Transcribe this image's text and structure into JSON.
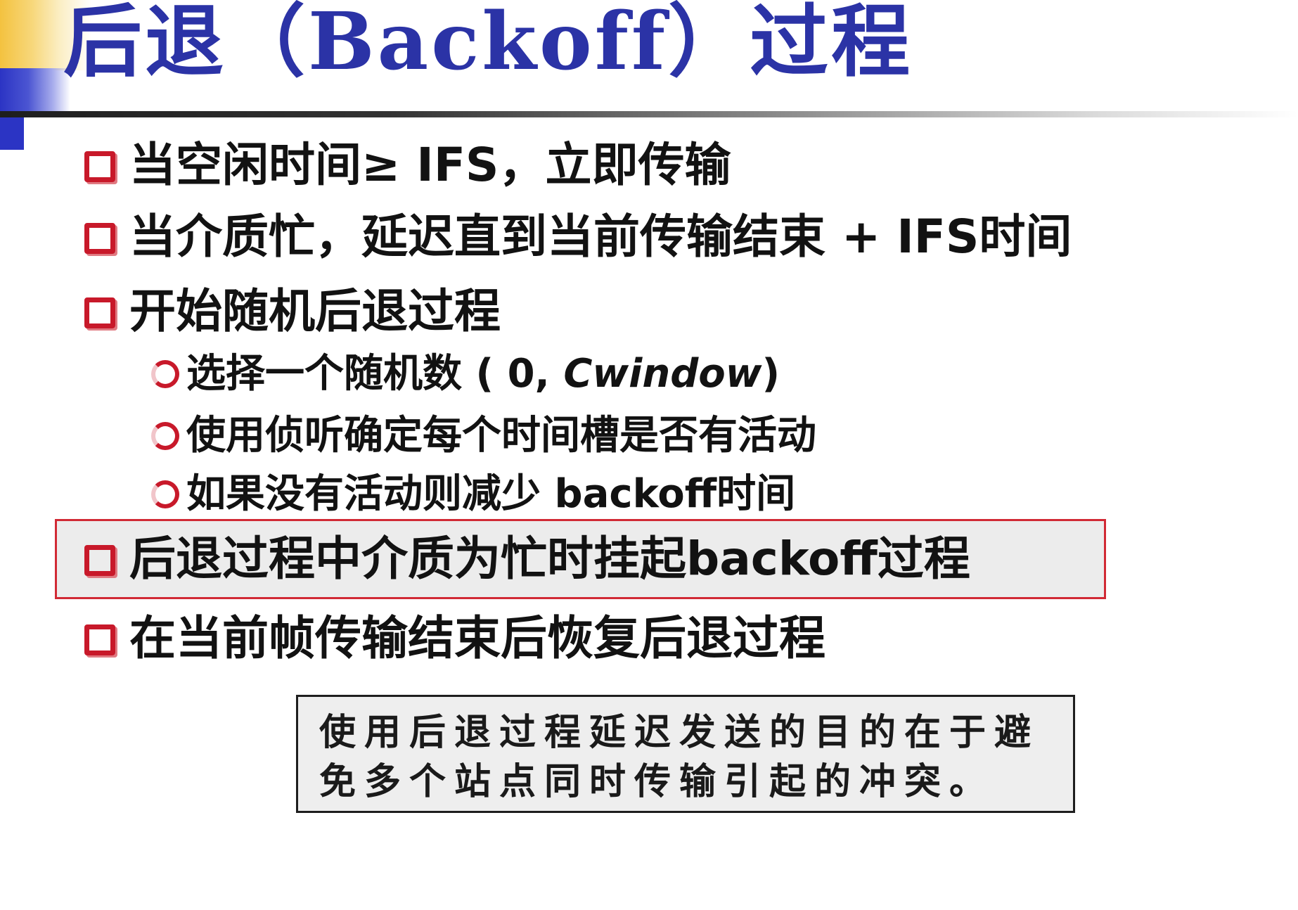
{
  "title": "后退（Backoff）过程",
  "colors": {
    "title": "#2b33a6",
    "marker": "#c8192a",
    "highlight_border": "#d12a35",
    "highlight_fill": "#ececec",
    "accent_yellow": "#f4c23f",
    "accent_blue": "#2b34c4"
  },
  "bullets": [
    {
      "level": 1,
      "marker": "square-icon",
      "text": "当空闲时间≥ IFS，立即传输"
    },
    {
      "level": 1,
      "marker": "square-icon",
      "text": "当介质忙，延迟直到当前传输结束 +  IFS时间"
    },
    {
      "level": 1,
      "marker": "square-icon",
      "text": "开始随机后退过程"
    },
    {
      "level": 2,
      "marker": "circle-icon",
      "text_prefix": "选择一个随机数 ( 0, ",
      "text_italic": "Cwindow",
      "text_suffix": ")"
    },
    {
      "level": 2,
      "marker": "circle-icon",
      "text": "使用侦听确定每个时间槽是否有活动"
    },
    {
      "level": 2,
      "marker": "circle-icon",
      "text": "如果没有活动则减少 backoff时间"
    },
    {
      "level": 1,
      "marker": "square-icon",
      "text": "后退过程中介质为忙时挂起backoff过程",
      "highlighted": true
    },
    {
      "level": 1,
      "marker": "square-icon",
      "text": "在当前帧传输结束后恢复后退过程"
    }
  ],
  "note": {
    "line1": "使用后退过程延迟发送的目的在于避",
    "line2": "免多个站点同时传输引起的冲突。"
  }
}
